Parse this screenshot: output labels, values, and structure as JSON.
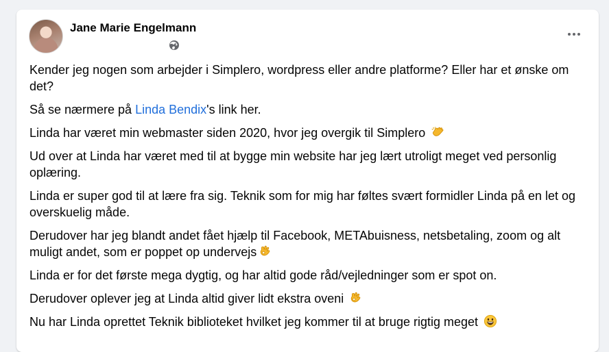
{
  "post": {
    "author_name": "Jane Marie Engelmann",
    "privacy_icon": "globe-icon",
    "more_icon": "more-horizontal-icon",
    "paragraphs": {
      "p1": "Kender jeg nogen som arbejder i Simplero, wordpress eller andre platforme? Eller har et ønske om det?",
      "p2_before": "Så se nærmere på ",
      "p2_link": "Linda Bendix",
      "p2_after": "'s link her.",
      "p3": "Linda har været min webmaster siden 2020, hvor jeg overgik til Simplero",
      "p3_emoji": "clapping-hands-emoji",
      "p4": "Ud over at Linda har været med til at bygge min website har jeg lært utroligt meget ved personlig oplæring.",
      "p5": "Linda er super god til at lære fra sig. Teknik som for mig har føltes svært formidler Linda på en let og overskuelig måde.",
      "p6": "Derudover har jeg blandt andet fået hjælp til Facebook, METAbuisness, netsbetaling, zoom og alt muligt andet, som er poppet op undervejs",
      "p6_emoji": "ok-hand-emoji",
      "p7": "Linda er for det første mega dygtig, og har altid gode råd/vejledninger som er spot on.",
      "p8": "Derudover oplever jeg  at Linda altid giver lidt ekstra oveni",
      "p8_emoji": "ok-hand-emoji",
      "p9": "Nu har Linda oprettet Teknik biblioteket hvilket jeg kommer til at bruge rigtig meget",
      "p9_emoji": "grinning-face-emoji"
    }
  },
  "colors": {
    "page_background": "#f0f2f5",
    "card_background": "#ffffff",
    "text": "#050505",
    "secondary_text": "#65676b",
    "link": "#216fdb"
  }
}
